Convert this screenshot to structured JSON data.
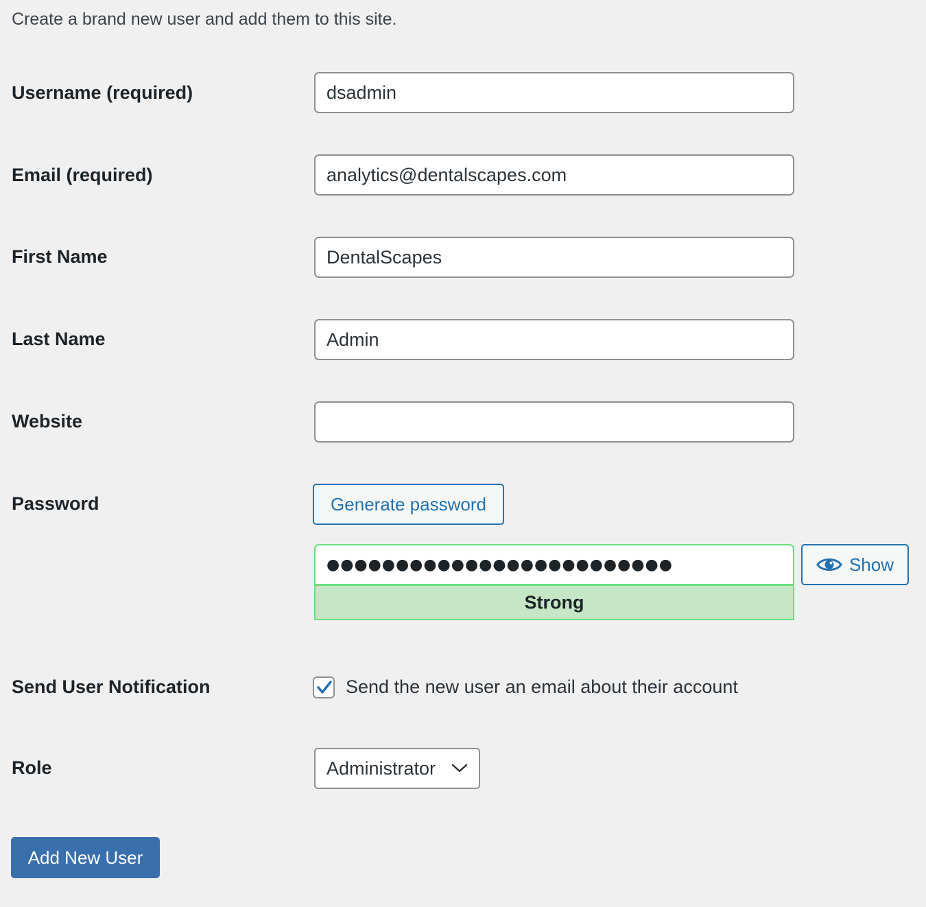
{
  "intro": "Create a brand new user and add them to this site.",
  "fields": {
    "username": {
      "label": "Username (required)",
      "value": "dsadmin"
    },
    "email": {
      "label": "Email (required)",
      "value": "analytics@dentalscapes.com"
    },
    "first_name": {
      "label": "First Name",
      "value": "DentalScapes"
    },
    "last_name": {
      "label": "Last Name",
      "value": "Admin"
    },
    "website": {
      "label": "Website",
      "value": ""
    }
  },
  "password": {
    "label": "Password",
    "generate_label": "Generate password",
    "value": "●●●●●●●●●●●●●●●●●●●●●●●●●",
    "strength": "Strong",
    "show_label": "Show",
    "show_icon": "eye-icon"
  },
  "notification": {
    "label": "Send User Notification",
    "checkbox_label": "Send the new user an email about their account",
    "checked": true
  },
  "role": {
    "label": "Role",
    "selected": "Administrator",
    "icon": "chevron-down-icon"
  },
  "submit_label": "Add New User",
  "colors": {
    "accent": "#2271b1",
    "primary_button": "#3a6fae",
    "strength_bg": "#c6e7c6",
    "strength_border": "#68de7c",
    "background": "#f0f0f1"
  }
}
